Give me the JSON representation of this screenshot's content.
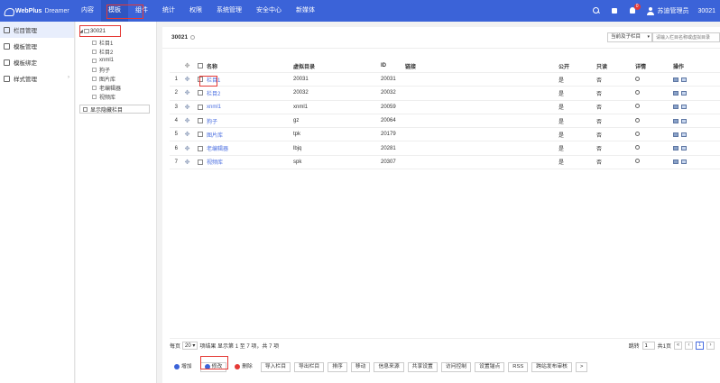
{
  "brand": {
    "name": "WebPlus",
    "sub": "Dreamer"
  },
  "nav": [
    "内容",
    "模板",
    "组件",
    "统计",
    "权限",
    "系统管理",
    "安全中心",
    "新媒体"
  ],
  "top_right": {
    "badge": "0",
    "user": "苏迪管理员",
    "site_id": "30021"
  },
  "sidebar": [
    "栏目管理",
    "模板管理",
    "模板绑定",
    "样式管理"
  ],
  "tree": {
    "root": "30021",
    "children": [
      "栏目1",
      "栏目2",
      "xnml1",
      "狗子",
      "图片库",
      "老编辑器",
      "视频库"
    ],
    "toggle": "显示隐藏栏目"
  },
  "main": {
    "title": "30021",
    "scope_select": "当前及子栏目",
    "search_placeholder": "请输入栏目名称或虚拟目录"
  },
  "table": {
    "headers": [
      "名称",
      "虚拟目录",
      "ID",
      "链接",
      "公开",
      "只读",
      "详情",
      "操作"
    ],
    "rows": [
      {
        "no": "1",
        "name": "栏目1",
        "dir": "20031",
        "id": "20031",
        "pub": "是",
        "ro": "否"
      },
      {
        "no": "2",
        "name": "栏目2",
        "dir": "20032",
        "id": "20032",
        "pub": "是",
        "ro": "否"
      },
      {
        "no": "3",
        "name": "xnml1",
        "dir": "xnml1",
        "id": "20059",
        "pub": "是",
        "ro": "否"
      },
      {
        "no": "4",
        "name": "狗子",
        "dir": "gz",
        "id": "20064",
        "pub": "是",
        "ro": "否"
      },
      {
        "no": "5",
        "name": "图片库",
        "dir": "tpk",
        "id": "20179",
        "pub": "是",
        "ro": "否"
      },
      {
        "no": "6",
        "name": "老编辑器",
        "dir": "lbjq",
        "id": "20281",
        "pub": "是",
        "ro": "否"
      },
      {
        "no": "7",
        "name": "视频库",
        "dir": "spk",
        "id": "20307",
        "pub": "是",
        "ro": "否"
      }
    ]
  },
  "pager": {
    "per_page_label": "每页",
    "page_size": "20",
    "summary": "项结果 显示第 1 至 7 项，共 7 项",
    "jump_label": "跳转",
    "jump_value": "1",
    "total_pages": "共1页",
    "current_page": "1"
  },
  "toolbar": [
    "增加",
    "修改",
    "删除",
    "导入栏目",
    "导出栏目",
    "排序",
    "移动",
    "信息来源",
    "共享设置",
    "访问控制",
    "设置锚点",
    "RSS",
    "跨站发布审核",
    ">"
  ]
}
